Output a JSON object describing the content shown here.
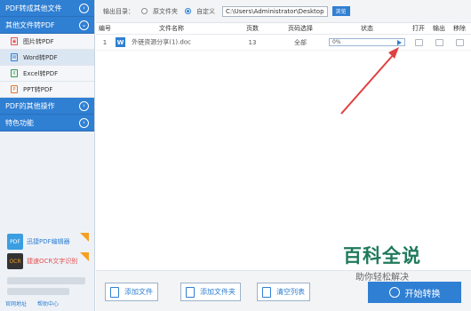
{
  "sidebar": {
    "categories": [
      {
        "label": "PDF转成其他文件"
      },
      {
        "label": "其他文件转PDF"
      },
      {
        "label": "PDF的其他操作"
      },
      {
        "label": "特色功能"
      }
    ],
    "subitems": [
      {
        "label": "图片转PDF"
      },
      {
        "label": "Word转PDF"
      },
      {
        "label": "Excel转PDF"
      },
      {
        "label": "PPT转PDF"
      }
    ],
    "promos": [
      {
        "label": "迅捷PDF编辑器"
      },
      {
        "label": "捷速OCR文字识别"
      }
    ],
    "footer_links": [
      "官网地址",
      "帮助中心"
    ]
  },
  "output": {
    "label": "输出目录：",
    "option_original": "原文件夹",
    "option_custom": "自定义",
    "path": "C:\\Users\\Administrator\\Desktop",
    "browse_label": "浏览"
  },
  "table": {
    "headers": {
      "no": "编号",
      "name": "文件名称",
      "pages": "页数",
      "range": "页码选择",
      "status": "状态",
      "open": "打开",
      "out": "输出",
      "del": "移除"
    },
    "rows": [
      {
        "no": "1",
        "name": "外链资源分享(1).doc",
        "pages": "13",
        "range": "全部",
        "progress_text": "0%",
        "progress": 0
      }
    ]
  },
  "buttons": {
    "add_file": "添加文件",
    "add_folder": "添加文件夹",
    "clear": "清空列表",
    "start": "开始转换"
  },
  "watermark": {
    "title": "百科全说",
    "subtitle": "助你轻松解决"
  },
  "colors": {
    "accent": "#2f7fd3",
    "arrow": "#e04040"
  }
}
